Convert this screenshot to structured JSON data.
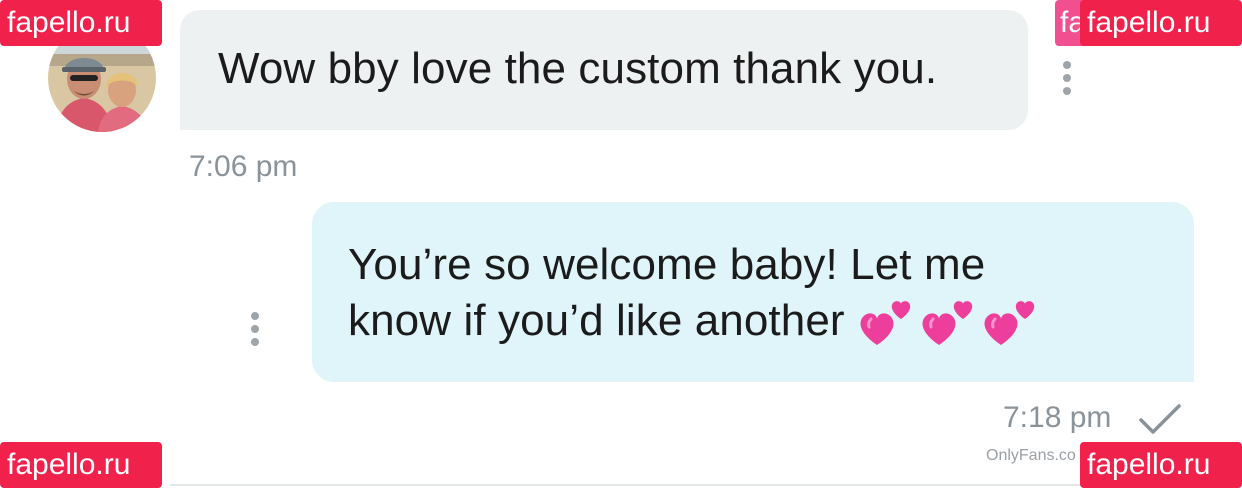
{
  "conversation": {
    "incoming": {
      "text": "Wow bby love the custom thank you.",
      "time": "7:06 pm"
    },
    "outgoing": {
      "line1": "You’re so welcome baby! Let me",
      "line2": "know if you’d like another",
      "emojis": [
        "two-hearts-emoji",
        "two-hearts-emoji",
        "two-hearts-emoji"
      ],
      "time": "7:18 pm",
      "status_icon": "check-icon"
    }
  },
  "watermarks": {
    "top_left": "fapello.ru",
    "top_right_ghost": "fa",
    "top_right": "fapello.ru",
    "bottom_left": "fapello.ru",
    "bottom_right": "fapello.ru",
    "footer": "OnlyFans.co"
  },
  "colors": {
    "incoming_bubble": "#eef1f2",
    "outgoing_bubble": "#dff5fa",
    "watermark": "#f0224b",
    "timestamp": "#8a9399"
  }
}
